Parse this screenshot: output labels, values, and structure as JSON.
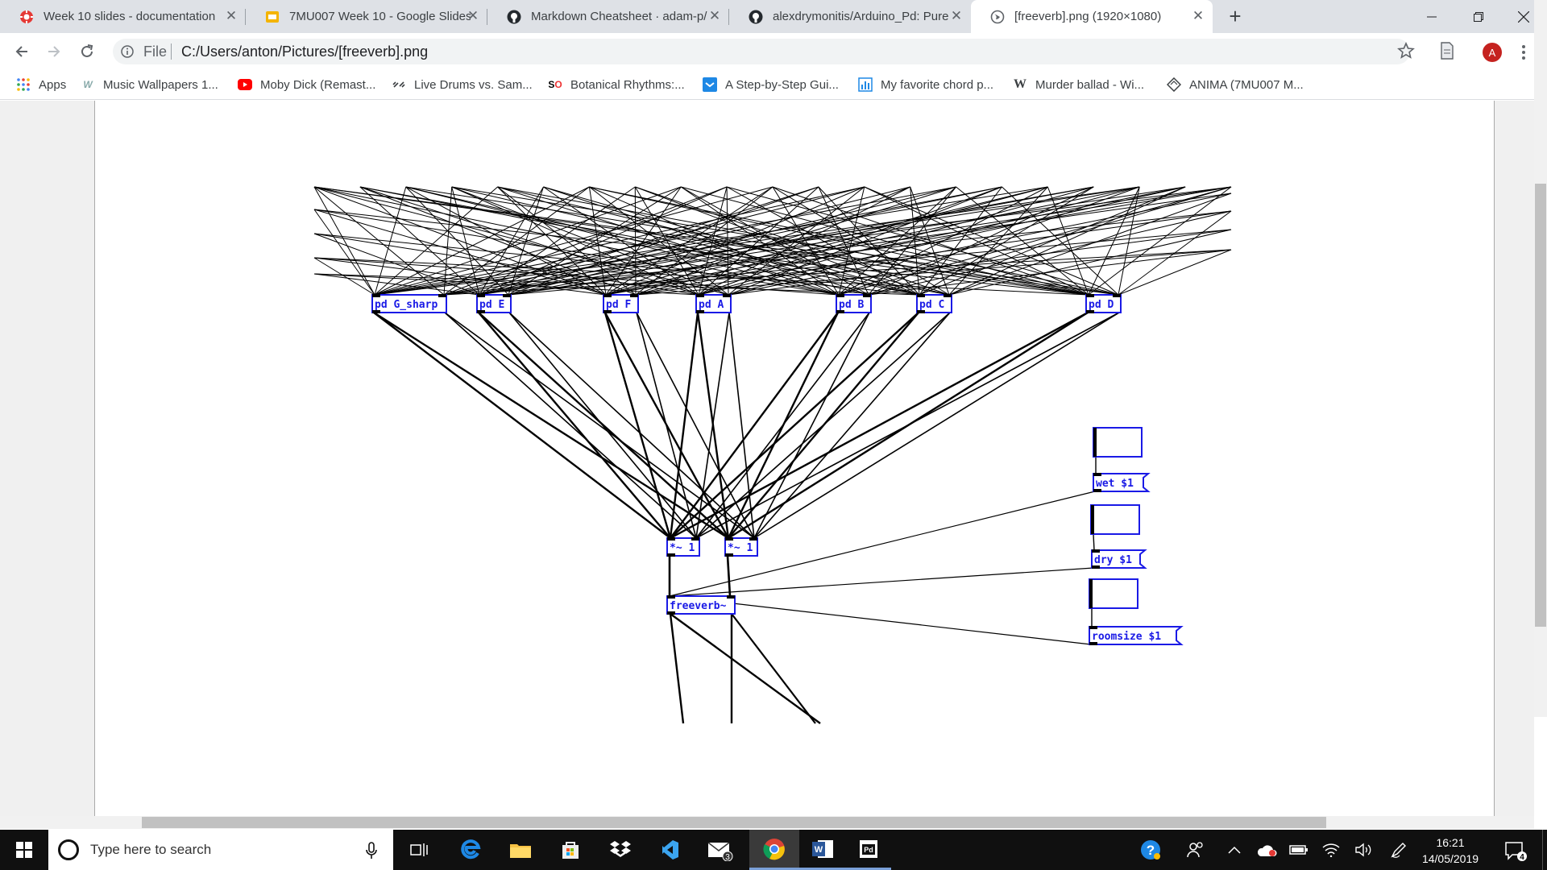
{
  "browser": {
    "tabs": [
      {
        "title": "Week 10 slides - documentation",
        "icon": "gear-red-icon"
      },
      {
        "title": "7MU007 Week 10 - Google Slides",
        "icon": "google-slides-icon"
      },
      {
        "title": "Markdown Cheatsheet · adam-p/",
        "icon": "github-icon"
      },
      {
        "title": "alexdrymonitis/Arduino_Pd: Pure",
        "icon": "github-icon"
      },
      {
        "title": "[freeverb].png (1920×1080)",
        "icon": "globe-icon",
        "active": true
      }
    ],
    "new_tab_label": "+",
    "address": {
      "scheme_label": "File",
      "url": "C:/Users/anton/Pictures/[freeverb].png"
    },
    "avatar_letter": "A",
    "bookmarks": [
      {
        "label": "Apps",
        "icon": "apps-grid-icon"
      },
      {
        "label": "Music Wallpapers 1...",
        "icon": "w-logo-icon"
      },
      {
        "label": "Moby Dick (Remast...",
        "icon": "youtube-icon"
      },
      {
        "label": "Live Drums vs. Sam...",
        "icon": "link-icon"
      },
      {
        "label": "Botanical Rhythms:...",
        "icon": "so-icon"
      },
      {
        "label": "A Step-by-Step Gui...",
        "icon": "blue-bookmark-icon"
      },
      {
        "label": "My favorite chord p...",
        "icon": "chart-icon"
      },
      {
        "label": "Murder ballad - Wi...",
        "icon": "wikipedia-icon"
      },
      {
        "label": "ANIMA (7MU007 M...",
        "icon": "diamond-icon"
      }
    ]
  },
  "patch": {
    "pitch_objects": [
      "pd G_sharp",
      "pd E",
      "pd F",
      "pd A",
      "pd B",
      "pd C",
      "pd D"
    ],
    "gain_objects": [
      "*~ 1",
      "*~ 1"
    ],
    "reverb_object": "freeverb~",
    "messages": [
      "wet $1",
      "dry $1",
      "roomsize $1"
    ],
    "number_boxes": 3
  },
  "taskbar": {
    "search_placeholder": "Type here to search",
    "mail_badge": "3",
    "time": "16:21",
    "date": "14/05/2019",
    "notification_count": "4",
    "pinned_apps": [
      "task-view-icon",
      "edge-icon",
      "file-explorer-icon",
      "store-icon",
      "dropbox-icon",
      "visual-studio-icon",
      "mail-icon",
      "chrome-icon",
      "word-icon",
      "pd-icon"
    ],
    "colors": {
      "taskbar": "#101010",
      "tab_bar": "#dee1e6",
      "pd_blue": "#1a1ae6"
    }
  }
}
